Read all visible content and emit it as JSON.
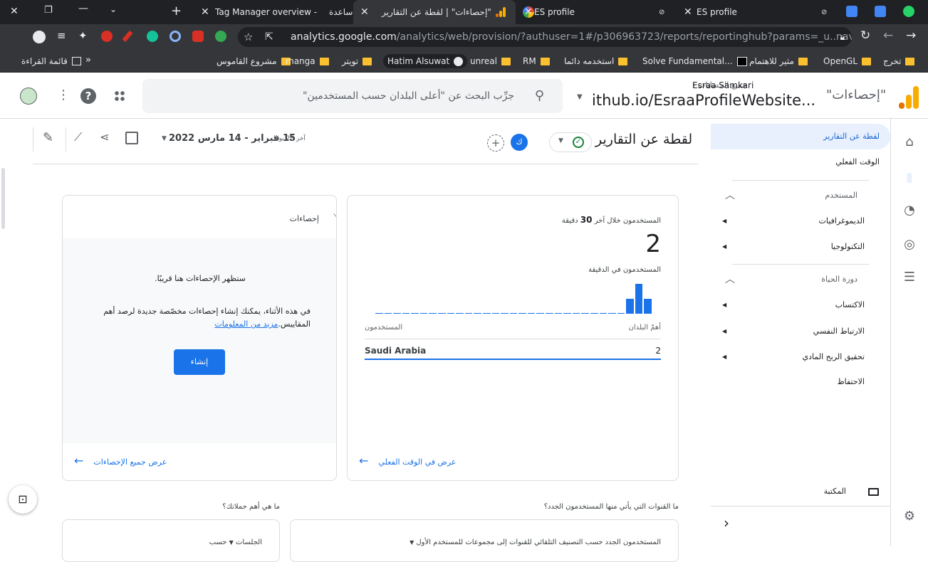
{
  "tabs": [
    {
      "title": "ساعدة",
      "active": false
    },
    {
      "title": "Tag Manager overview -",
      "active": false
    },
    {
      "title": "\"إحصاءات\" | لقطة عن التقارير",
      "active": true
    },
    {
      "title": "ES profile",
      "active": false
    },
    {
      "title": "ES profile",
      "active": false
    }
  ],
  "address": {
    "host": "analytics.google.com",
    "path": "/analytics/web/provision/?authuser=1#/p306963723/reports/reportinghub?params=_u..nav%3Dmaui"
  },
  "bookmarks": [
    "تخرج",
    "OpenGL",
    "مثير للاهتمام",
    "Solve Fundamental...",
    "استخدمه دائما",
    "RM",
    "unreal",
    "Hatim Alsuwat",
    "تويتر",
    "manga",
    "مشروع القاموس"
  ],
  "reading_list": "قائمة القراءة",
  "ga": {
    "product": "\"إحصاءات\"",
    "breadcrumb": "جميع الحسابات",
    "account": "Esraa Samkari",
    "property": "ithub.io/EsraaProfileWebsite...",
    "search_placeholder": "جرِّب البحث عن \"أعلى البلدان حسب المستخدمين\""
  },
  "nav": {
    "snapshot": "لقطة عن التقارير",
    "realtime": "الوقت الفعلي",
    "user_section": "المستخدم",
    "demographics": "الديموغرافيات",
    "tech": "التكنولوجيا",
    "lifecycle_section": "دورة الحياة",
    "acquisition": "الاكتساب",
    "engagement": "الارتباط النفسي",
    "monetization": "تحقيق الربح المادي",
    "retention": "الاحتفاظ",
    "library": "المكتبة"
  },
  "page": {
    "title": "لقطة عن التقارير",
    "avatar_letter": "ك",
    "date_prefix": "آخر 28 يومًا",
    "date_range": "15 فبراير - 14 مارس 2022"
  },
  "realtime_card": {
    "label_prefix": "المستخدمون خلال آخر",
    "label_num": "30",
    "label_suffix": "دقيقة",
    "value": "2",
    "per_minute_label": "المستخدمون في الدقيقة",
    "col_country": "أهمّ البلدان",
    "col_users": "المستخدمون",
    "rows": [
      {
        "country": "Saudi Arabia",
        "users": "2"
      }
    ],
    "footer_link": "عرض في الوقت الفعلي"
  },
  "chart_data": {
    "type": "bar",
    "title": "المستخدمون في الدقيقة",
    "xlabel": "",
    "ylabel": "",
    "values": [
      0,
      0,
      0,
      0,
      0,
      0,
      0,
      0,
      0,
      0,
      0,
      0,
      0,
      0,
      0,
      0,
      0,
      0,
      0,
      0,
      0,
      0,
      0,
      0,
      0,
      0,
      0,
      0,
      1,
      2,
      1
    ]
  },
  "insights_card": {
    "title": "إحصاءات",
    "line1": "ستظهر الإحصاءات هنا قريبًا.",
    "line2": "في هذه الأثناء، يمكنك إنشاء إحصاءات مخصّصة جديدة لرصد أهم المقاييس.",
    "learn_more": "مزيد من المعلومات",
    "create_button": "إنشاء",
    "footer_link": "عرض جميع الإحصاءات"
  },
  "bottom": {
    "q1": "ما القنوات التي يأتي منها المستخدمون الجدد؟",
    "q2": "ما هي أهم حملاتك؟",
    "card1_text": "المستخدمون الجدد حسب التصنيف التلقائي للقنوات إلى مجموعات للمستخدم الأول",
    "card2_text": "الجلسات",
    "card2_suffix": "حسب"
  }
}
